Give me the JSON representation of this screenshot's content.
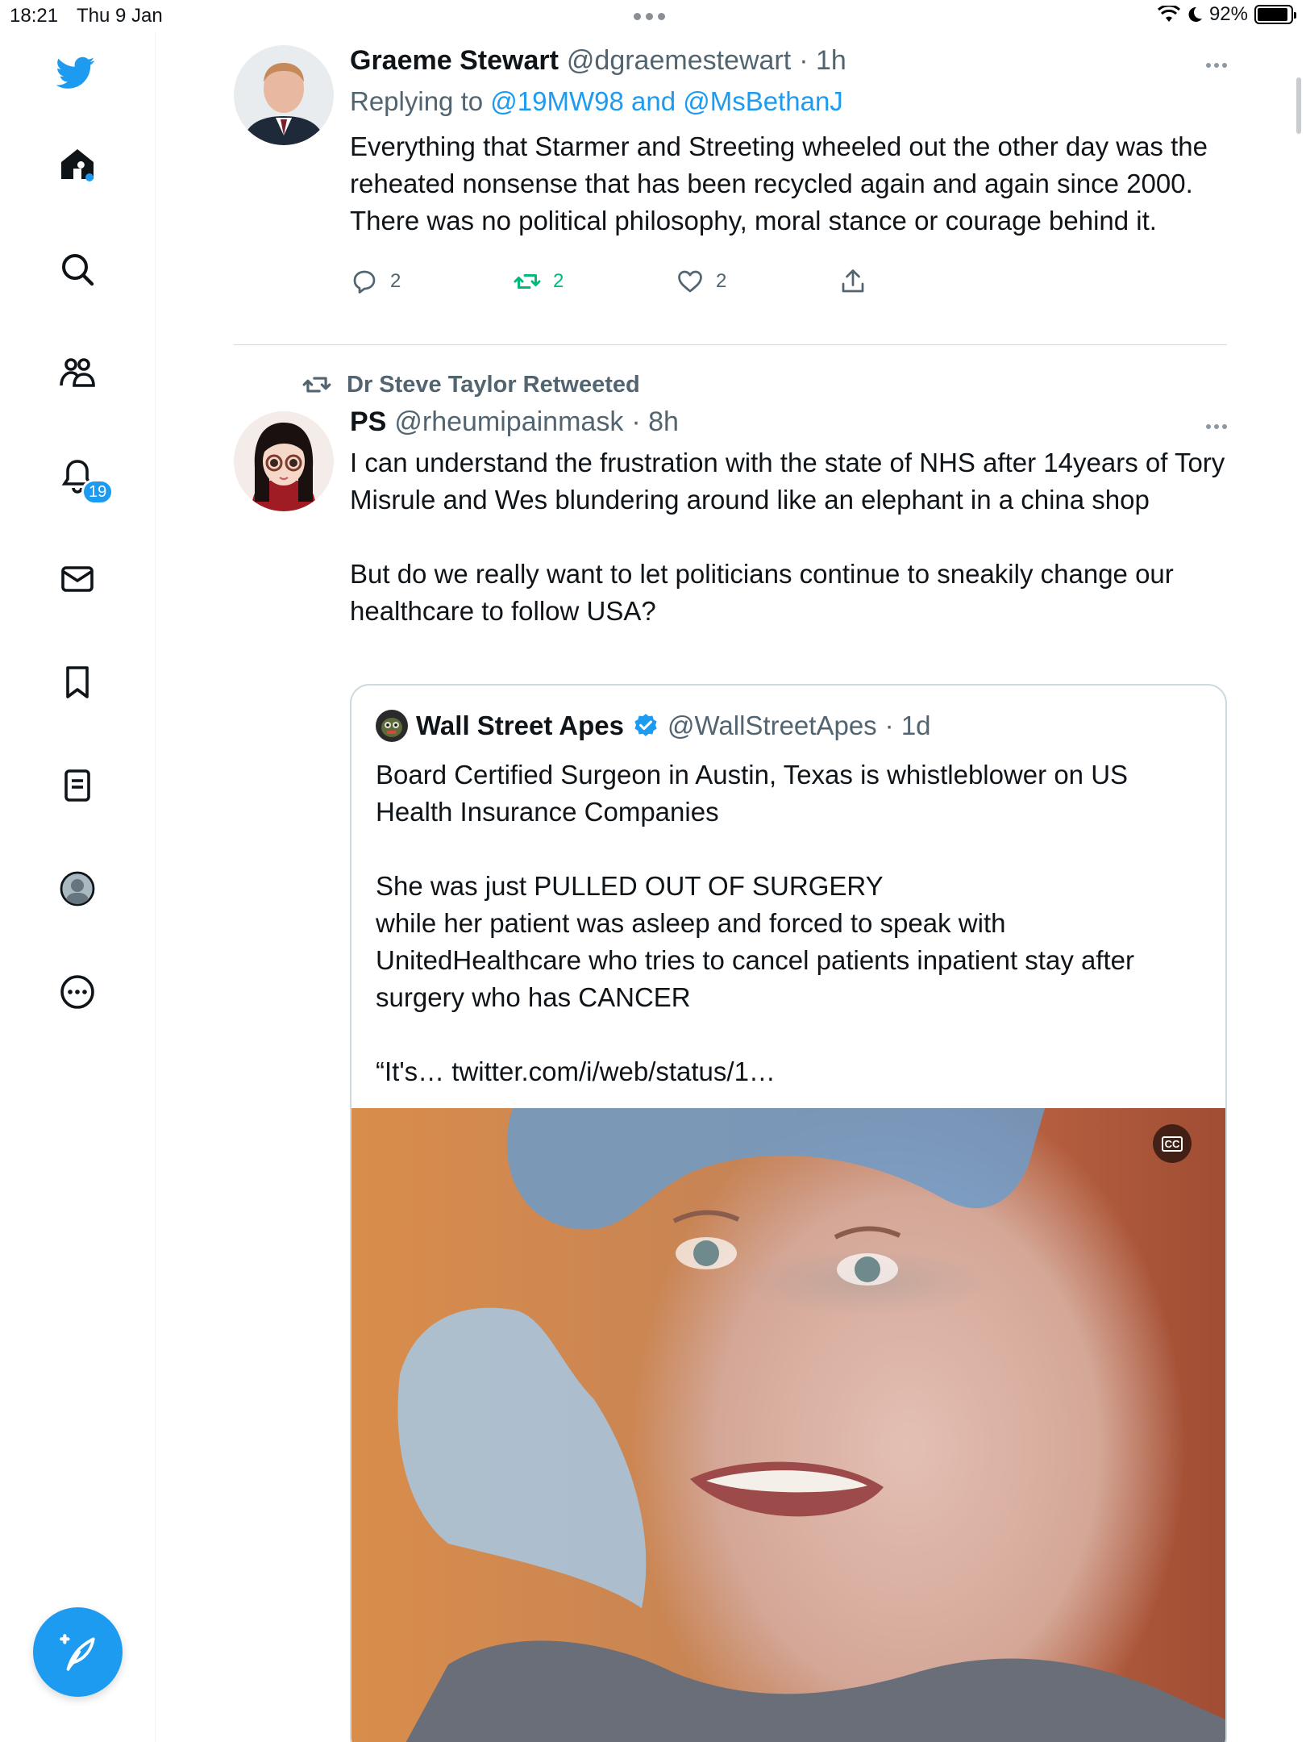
{
  "status_bar": {
    "time": "18:21",
    "date": "Thu 9 Jan",
    "battery": "92%",
    "battery_level": 0.92
  },
  "sidebar": {
    "items": [
      {
        "icon": "twitter-bird-icon"
      },
      {
        "icon": "home-icon"
      },
      {
        "icon": "search-icon"
      },
      {
        "icon": "communities-icon"
      },
      {
        "icon": "notifications-bell-icon",
        "badge": "19"
      },
      {
        "icon": "messages-envelope-icon"
      },
      {
        "icon": "bookmark-icon"
      },
      {
        "icon": "lists-icon"
      },
      {
        "icon": "profile-avatar-icon"
      },
      {
        "icon": "more-circle-icon"
      }
    ],
    "compose_icon": "compose-tweet-icon"
  },
  "colors": {
    "accent": "#1d9bf0",
    "retweet_green": "#00ba7c",
    "secondary_text": "#536471"
  },
  "feed": {
    "tweet1": {
      "name": "Graeme Stewart",
      "handle": "@dgraemestewart",
      "time": "· 1h",
      "replying_prefix": "Replying to",
      "replying_targets": "@19MW98 and @MsBethanJ",
      "text": "Everything that Starmer and Streeting wheeled out the other day was the reheated nonsense that has been recycled again and again since 2000. There was no political philosophy, moral stance or courage behind it.",
      "replies": "2",
      "retweets": "2",
      "likes": "2"
    },
    "tweet2": {
      "retweeted_by": "Dr Steve Taylor Retweeted",
      "name": "PS",
      "handle": "@rheumipainmask",
      "time": "· 8h",
      "text": "I can understand the frustration with the state of NHS after 14years of Tory Misrule and Wes blundering around like an elephant in a china shop\n\nBut do we really want to let politicians continue to sneakily change our healthcare to follow USA?",
      "quote": {
        "name": "Wall Street Apes",
        "handle": "@WallStreetApes",
        "time": "· 1d",
        "text": "Board Certified Surgeon in Austin, Texas is whistleblower on US Health Insurance Companies\n\nShe was just PULLED OUT OF SURGERY\nwhile her patient was asleep and forced to speak with UnitedHealthcare who tries to cancel patients inpatient stay after surgery who has CANCER\n\n“It's… twitter.com/i/web/status/1…",
        "cc_label": "CC"
      }
    }
  }
}
